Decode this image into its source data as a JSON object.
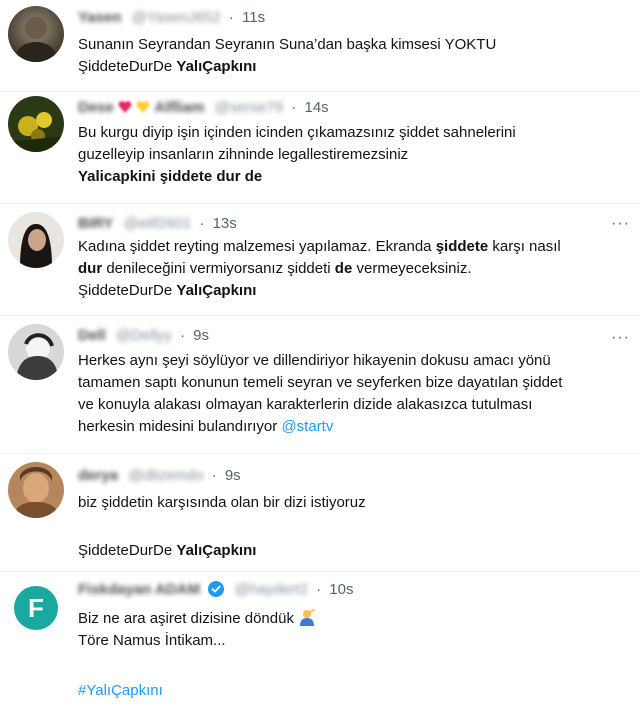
{
  "tweets": [
    {
      "name": "Yasen",
      "handle": "@YasenJ652",
      "time": "11s",
      "lines": [
        [
          {
            "t": "Sunanın Seyrandan Seyranın Suna’dan başka kimsesi YOKTU"
          }
        ],
        [
          {
            "t": "ŞiddeteDurDe "
          },
          {
            "t": "YalıÇapkını",
            "b": true
          }
        ]
      ]
    },
    {
      "name": "Dese",
      "name_suffix": "Alfliam",
      "handle": "@serse79",
      "time": "14s",
      "lines": [
        [
          {
            "t": "Bu kurgu diyip işin içinden icinden çıkamazsınız şiddet sahnelerini"
          }
        ],
        [
          {
            "t": "guzelleyip insanların zihninde legallestiremezsiniz"
          }
        ],
        [
          {
            "t": "Yalicapkini şiddete dur de",
            "b": true
          }
        ]
      ]
    },
    {
      "name": "BIRY",
      "handle": "@elif2601",
      "time": "13s",
      "lines": [
        [
          {
            "t": "Kadına şiddet reyting  malzemesi yapılamaz. Ekranda "
          },
          {
            "t": "şiddete",
            "b": true
          },
          {
            "t": " karşı nasıl"
          }
        ],
        [
          {
            "t": "dur",
            "b": true
          },
          {
            "t": " denileceğini vermiyorsanız şiddeti "
          },
          {
            "t": "de",
            "b": true
          },
          {
            "t": " vermeyeceksiniz."
          }
        ],
        [
          {
            "t": "ŞiddeteDurDe "
          },
          {
            "t": "YalıÇapkını",
            "b": true
          }
        ]
      ]
    },
    {
      "name": "Dell",
      "handle": "@Dellyy",
      "time": "9s",
      "lines": [
        [
          {
            "t": "Herkes aynı şeyi söylüyor ve  dillendiriyor hikayenin dokusu amacı yönü"
          }
        ],
        [
          {
            "t": "tamamen saptı konunun temeli seyran ve seyferken bize dayatılan şiddet"
          }
        ],
        [
          {
            "t": "ve konuyla alakası olmayan karakterlerin dizide alakasızca tutulması"
          }
        ],
        [
          {
            "t": "herkesin midesini bulandırıyor "
          },
          {
            "t": "@startv",
            "link": true
          }
        ]
      ]
    },
    {
      "name": "derya",
      "handle": "@dlizemdo",
      "time": "9s",
      "lines": [
        [
          {
            "t": "biz şiddetin karşısında olan bir dizi istiyoruz"
          }
        ],
        [
          {
            "t": ""
          }
        ],
        [
          {
            "t": "ŞiddeteDurDe "
          },
          {
            "t": "YalıÇapkını",
            "b": true
          }
        ]
      ]
    },
    {
      "name": "Fiskdayan ADAM",
      "handle": "@haydert2",
      "time": "10s",
      "lines": [
        [
          {
            "t": "Biz ne ara aşiret dizisine döndük "
          }
        ],
        [
          {
            "t": "Töre Namus İntikam..."
          }
        ],
        [
          {
            "t": ""
          }
        ],
        [
          {
            "t": "#YalıÇapkını",
            "link": true
          }
        ]
      ]
    }
  ],
  "colors": {
    "link": "#1d9bf0",
    "muted": "#536471",
    "verified": "#1d9bf0"
  },
  "icons": {
    "more": "more-icon",
    "verified": "verified-badge-icon",
    "emoji": "person-emoji-icon"
  }
}
